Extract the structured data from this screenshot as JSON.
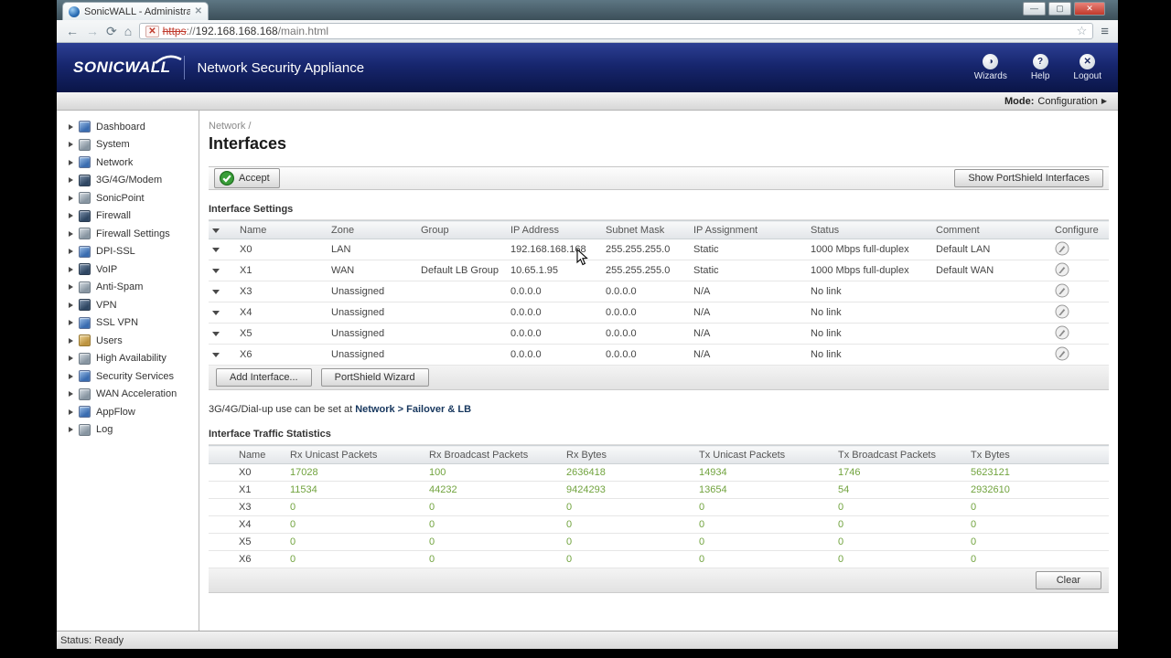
{
  "colors": {
    "header_navy_top": "#2c3f93",
    "header_navy_bottom": "#0a1547",
    "stat_green": "#71a33e",
    "link_navy": "#17375e",
    "close_red": "#c0392b"
  },
  "browser": {
    "tab_title": "SonicWALL - Administrati",
    "url": {
      "scheme": "https",
      "separator": "://",
      "host": "192.168.168.168",
      "path": "/main.html"
    },
    "icons": {
      "back": "←",
      "forward": "→",
      "reload": "⟳",
      "home": "⌂",
      "star": "☆",
      "menu": "≡",
      "cert_error": "✕",
      "tab_close": "✕",
      "minimize": "—",
      "maximize": "▢",
      "close": "✕"
    }
  },
  "header": {
    "logo": "SONICWALL",
    "product": "Network Security Appliance",
    "actions": [
      {
        "label": "Wizards",
        "glyph": "◑"
      },
      {
        "label": "Help",
        "glyph": "?"
      },
      {
        "label": "Logout",
        "glyph": "✕"
      }
    ]
  },
  "mode_bar": {
    "label": "Mode:",
    "value": "Configuration",
    "arrow": "▶"
  },
  "sidebar": {
    "items": [
      {
        "label": "Dashboard"
      },
      {
        "label": "System"
      },
      {
        "label": "Network"
      },
      {
        "label": "3G/4G/Modem"
      },
      {
        "label": "SonicPoint"
      },
      {
        "label": "Firewall"
      },
      {
        "label": "Firewall Settings"
      },
      {
        "label": "DPI-SSL"
      },
      {
        "label": "VoIP"
      },
      {
        "label": "Anti-Spam"
      },
      {
        "label": "VPN"
      },
      {
        "label": "SSL VPN"
      },
      {
        "label": "Users"
      },
      {
        "label": "High Availability"
      },
      {
        "label": "Security Services"
      },
      {
        "label": "WAN Acceleration"
      },
      {
        "label": "AppFlow"
      },
      {
        "label": "Log"
      }
    ]
  },
  "content": {
    "breadcrumb": "Network /",
    "title": "Interfaces",
    "accept_label": "Accept",
    "show_portshield_label": "Show PortShield Interfaces",
    "interface_settings": {
      "title": "Interface Settings",
      "columns": [
        "Name",
        "Zone",
        "Group",
        "IP Address",
        "Subnet Mask",
        "IP Assignment",
        "Status",
        "Comment",
        "Configure"
      ],
      "rows": [
        {
          "name": "X0",
          "zone": "LAN",
          "group": "",
          "ip": "192.168.168.168",
          "subnet": "255.255.255.0",
          "assignment": "Static",
          "status": "1000 Mbps full-duplex",
          "comment": "Default LAN"
        },
        {
          "name": "X1",
          "zone": "WAN",
          "group": "Default LB Group",
          "ip": "10.65.1.95",
          "subnet": "255.255.255.0",
          "assignment": "Static",
          "status": "1000 Mbps full-duplex",
          "comment": "Default WAN"
        },
        {
          "name": "X3",
          "zone": "Unassigned",
          "group": "",
          "ip": "0.0.0.0",
          "subnet": "0.0.0.0",
          "assignment": "N/A",
          "status": "No link",
          "comment": ""
        },
        {
          "name": "X4",
          "zone": "Unassigned",
          "group": "",
          "ip": "0.0.0.0",
          "subnet": "0.0.0.0",
          "assignment": "N/A",
          "status": "No link",
          "comment": ""
        },
        {
          "name": "X5",
          "zone": "Unassigned",
          "group": "",
          "ip": "0.0.0.0",
          "subnet": "0.0.0.0",
          "assignment": "N/A",
          "status": "No link",
          "comment": ""
        },
        {
          "name": "X6",
          "zone": "Unassigned",
          "group": "",
          "ip": "0.0.0.0",
          "subnet": "0.0.0.0",
          "assignment": "N/A",
          "status": "No link",
          "comment": ""
        }
      ],
      "add_interface_label": "Add Interface...",
      "portshield_wizard_label": "PortShield Wizard"
    },
    "note": {
      "prefix": "3G/4G/Dial-up use can be set at ",
      "link": "Network > Failover & LB"
    },
    "traffic_stats": {
      "title": "Interface Traffic Statistics",
      "columns": [
        "Name",
        "Rx Unicast Packets",
        "Rx Broadcast Packets",
        "Rx Bytes",
        "Tx Unicast Packets",
        "Tx Broadcast Packets",
        "Tx Bytes"
      ],
      "rows": [
        {
          "name": "X0",
          "values": [
            "17028",
            "100",
            "2636418",
            "14934",
            "1746",
            "5623121"
          ]
        },
        {
          "name": "X1",
          "values": [
            "11534",
            "44232",
            "9424293",
            "13654",
            "54",
            "2932610"
          ]
        },
        {
          "name": "X3",
          "values": [
            "0",
            "0",
            "0",
            "0",
            "0",
            "0"
          ]
        },
        {
          "name": "X4",
          "values": [
            "0",
            "0",
            "0",
            "0",
            "0",
            "0"
          ]
        },
        {
          "name": "X5",
          "values": [
            "0",
            "0",
            "0",
            "0",
            "0",
            "0"
          ]
        },
        {
          "name": "X6",
          "values": [
            "0",
            "0",
            "0",
            "0",
            "0",
            "0"
          ]
        }
      ],
      "clear_label": "Clear"
    }
  },
  "status_bar": {
    "text": "Status: Ready"
  }
}
